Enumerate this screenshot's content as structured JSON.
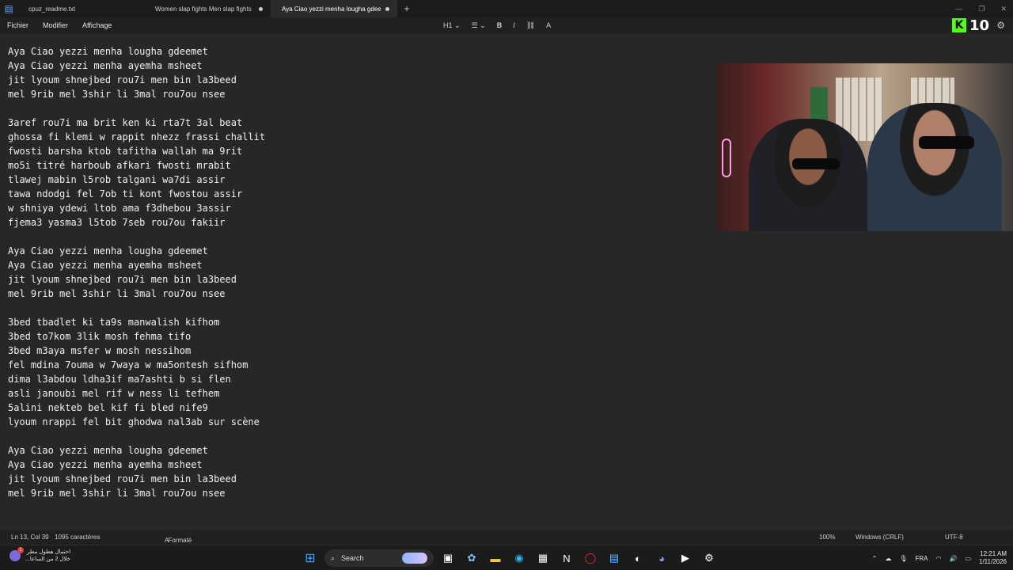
{
  "tabs": [
    {
      "label": "cpuz_readme.txt"
    },
    {
      "label": "Women slap fights  Men slap fights"
    },
    {
      "label": "Aya Ciao yezzi menha lougha gdee"
    }
  ],
  "new_tab_glyph": "+",
  "window_controls": [
    "—",
    "❐",
    "✕"
  ],
  "menu": {
    "fichier": "Fichier",
    "modifier": "Modifier",
    "affichage": "Affichage"
  },
  "format_toolbar": {
    "heading": "H1",
    "heading_chevron": "⌄",
    "list_glyph": "☰",
    "list_chevron": "⌄",
    "bold": "B",
    "italic": "I",
    "link_glyph": "⛓",
    "clear_glyph": "A"
  },
  "overlay": {
    "brand_letter": "K",
    "count": "10",
    "brand_color": "#53fc18"
  },
  "editor": {
    "lines": [
      "Aya Ciao yezzi menha lougha gdeemet",
      "Aya Ciao yezzi menha ayemha msheet",
      "jit lyoum shnejbed rou7i men bin la3beed",
      "mel 9rib mel 3shir li 3mal rou7ou nsee",
      "",
      "3aref rou7i ma brit ken ki rta7t 3al beat",
      "ghossa fi klemi w rappit nhezz frassi challit",
      "fwosti barsha ktob tafitha wallah ma 9rit",
      "mo5i titré harboub afkari fwosti mrabit",
      "tlawej mabin l5rob talgani wa7di assir",
      "tawa ndodgi fel 7ob ti kont fwostou assir",
      "w shniya ydewi ltob ama f3dhebou 3assir",
      "fjema3 yasma3 l5tob 7seb rou7ou fakiir",
      "",
      "Aya Ciao yezzi menha lougha gdeemet",
      "Aya Ciao yezzi menha ayemha msheet",
      "jit lyoum shnejbed rou7i men bin la3beed",
      "mel 9rib mel 3shir li 3mal rou7ou nsee",
      "",
      "3bed tbadlet ki ta9s manwalish kifhom",
      "3bed to7kom 3lik mosh fehma tifo",
      "3bed m3aya msfer w mosh nessihom",
      "fel mdina 7ouma w 7waya w ma5ontesh sifhom",
      "dima l3abdou ldha3if ma7ashti b si flen",
      "asli janoubi mel rif w ness li tefhem",
      "5alini nekteb bel kif fi bled nife9",
      "lyoum nrappi fel bit ghodwa nal3ab sur scène",
      "",
      "Aya Ciao yezzi menha lougha gdeemet",
      "Aya Ciao yezzi menha ayemha msheet",
      "jit lyoum shnejbed rou7i men bin la3beed",
      "mel 9rib mel 3shir li 3mal rou7ou nsee"
    ]
  },
  "status": {
    "position": "Ln 13, Col 39",
    "chars": "1095 caractères",
    "format": "Formaté",
    "zoom": "100%",
    "line_ending": "Windows (CRLF)",
    "encoding": "UTF-8"
  },
  "taskbar": {
    "news_badge": "1",
    "news_line1": "احتمال هطول مطر",
    "news_line2": "خلال 2 من الساعا...",
    "search_label": "Search",
    "tray_language": "FRA",
    "time": "12:21 AM",
    "date": "1/11/2026"
  }
}
